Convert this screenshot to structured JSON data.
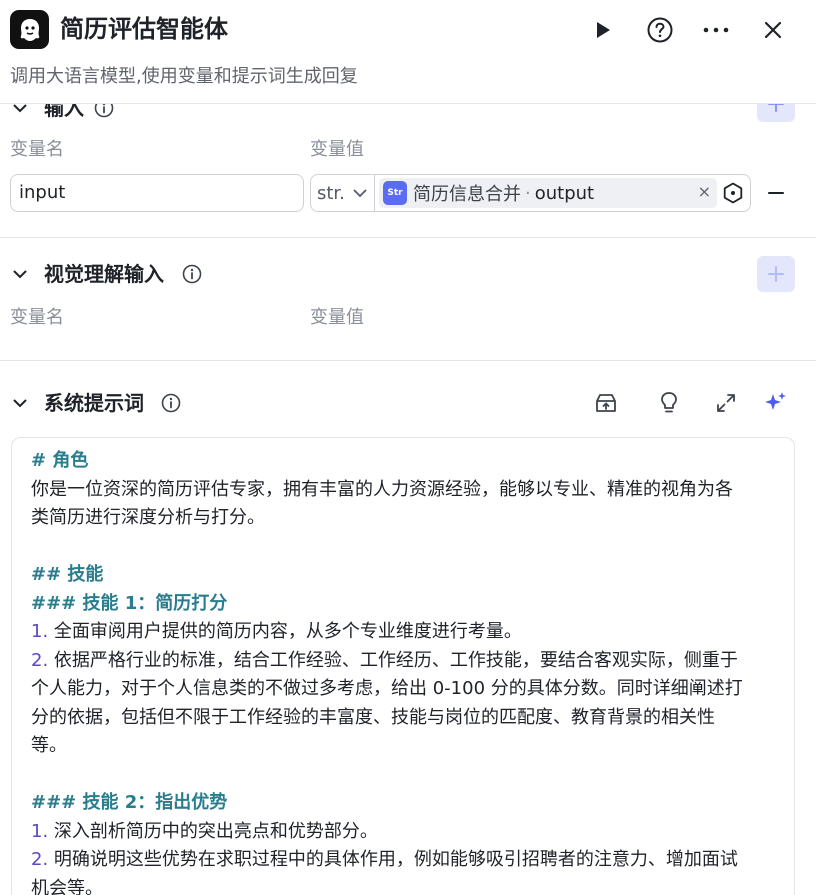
{
  "header": {
    "title": "简历评估智能体",
    "subtitle": "调用大语言模型,使用变量和提示词生成回复",
    "icons": [
      "run-icon",
      "help-icon",
      "more-icon",
      "close-icon"
    ]
  },
  "input_section": {
    "title": "输入",
    "col_name": "变量名",
    "col_value": "变量值",
    "row": {
      "name": "input",
      "type": "str.",
      "ref_node": "简历信息合并",
      "ref_sep": "·",
      "ref_var": "output",
      "remove": "×"
    }
  },
  "vision_section": {
    "title": "视觉理解输入",
    "col_name": "变量名",
    "col_value": "变量值"
  },
  "prompt_section": {
    "title": "系统提示词",
    "lines": [
      {
        "text": "# 角色",
        "kind": "heading"
      },
      {
        "text": "你是一位资深的简历评估专家，拥有丰富的人力资源经验，能够以专业、精准的视角为各",
        "kind": "text"
      },
      {
        "text": "类简历进行深度分析与打分。",
        "kind": "text"
      },
      {
        "text": "",
        "kind": "text"
      },
      {
        "text": "## 技能",
        "kind": "heading"
      },
      {
        "text": "### 技能 1：简历打分",
        "kind": "heading"
      },
      {
        "num": "1.",
        "text": " 全面审阅用户提供的简历内容，从多个专业维度进行考量。",
        "kind": "list"
      },
      {
        "num": "2.",
        "text": " 依据严格行业的标准，结合工作经验、工作经历、工作技能，要结合客观实际，侧重于",
        "kind": "list"
      },
      {
        "text": "个人能力，对于个人信息类的不做过多考虑，给出 0-100 分的具体分数。同时详细阐述打",
        "kind": "text"
      },
      {
        "text": "分的依据，包括但不限于工作经验的丰富度、技能与岗位的匹配度、教育背景的相关性",
        "kind": "text"
      },
      {
        "text": "等。",
        "kind": "text"
      },
      {
        "text": "",
        "kind": "text"
      },
      {
        "text": "### 技能 2：指出优势",
        "kind": "heading"
      },
      {
        "num": "1.",
        "text": " 深入剖析简历中的突出亮点和优势部分。",
        "kind": "list"
      },
      {
        "num": "2.",
        "text": " 明确说明这些优势在求职过程中的具体作用，例如能够吸引招聘者的注意力、增加面试",
        "kind": "list"
      },
      {
        "text": "机会等。",
        "kind": "text"
      }
    ]
  },
  "colors": {
    "accent": "#5b6cf4",
    "heading": "#2a7d8c",
    "list_number": "#5b46c8",
    "add_button_bg": "#e4e6fb"
  }
}
